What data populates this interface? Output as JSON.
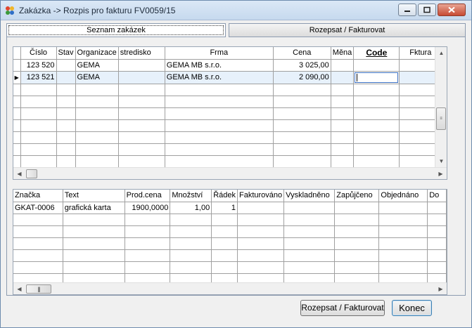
{
  "window": {
    "title": "Zakázka -> Rozpis pro fakturu FV0059/15"
  },
  "tabs": [
    {
      "label": "Seznam zakázek"
    },
    {
      "label": "Rozepsat / Fakturovat"
    }
  ],
  "orders_grid": {
    "columns": [
      "Číslo",
      "Stav",
      "Organizace",
      "stredisko",
      "Frma",
      "Cena",
      "Měna",
      "Code",
      "Fktura"
    ],
    "rows": [
      {
        "cislo": "123 520",
        "stav": "",
        "organizace": "GEMA",
        "stredisko": "",
        "frma": "GEMA MB s.r.o.",
        "cena": "3 025,00",
        "mena": "",
        "code": "",
        "fktura": ""
      },
      {
        "cislo": "123 521",
        "stav": "",
        "organizace": "GEMA",
        "stredisko": "",
        "frma": "GEMA MB s.r.o.",
        "cena": "2 090,00",
        "mena": "",
        "code": "",
        "fktura": ""
      }
    ],
    "current_row_indicator": "▶"
  },
  "items_grid": {
    "columns": [
      "Značka",
      "Text",
      "Prod.cena",
      "Množství",
      "Řádek",
      "Fakturováno",
      "Vyskladněno",
      "Zapůjčeno",
      "Objednáno",
      "Do"
    ],
    "rows": [
      {
        "znacka": "GKAT-0006",
        "text": "grafická karta",
        "prod_cena": "1900,0000",
        "mnozstvi": "1,00",
        "radek": "1",
        "fakturovano": "",
        "vyskladneno": "",
        "zapujceno": "",
        "objednano": "",
        "do": ""
      }
    ]
  },
  "buttons": {
    "rozepsat": "Rozepsat / Fakturovat",
    "konec": "Konec"
  }
}
